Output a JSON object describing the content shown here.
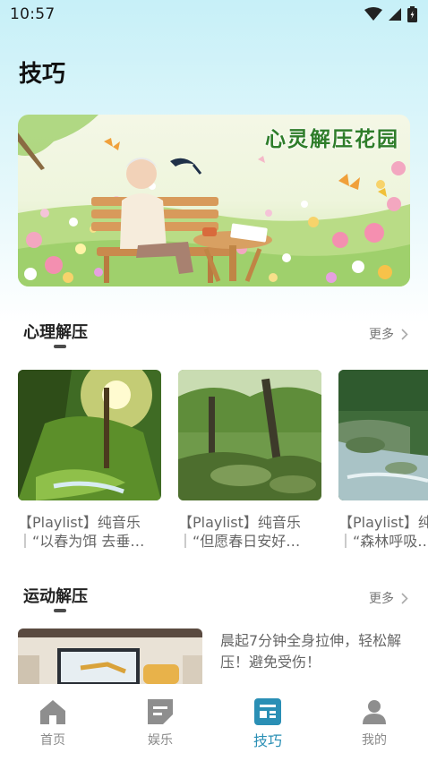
{
  "status_bar": {
    "time": "10:57"
  },
  "page": {
    "title": "技巧"
  },
  "banner": {
    "title": "心灵解压花园"
  },
  "sections": {
    "psych": {
      "title": "心理解压",
      "more": "更多"
    },
    "sport": {
      "title": "运动解压",
      "more": "更多"
    }
  },
  "playlists": [
    {
      "line1": "【Playlist】纯音乐",
      "line2": "｜“以春为饵 去垂…"
    },
    {
      "line1": "【Playlist】纯音乐",
      "line2": "｜“但愿春日安好…"
    },
    {
      "line1": "【Playlist】纯音乐",
      "line2": "｜“森林呼吸…"
    }
  ],
  "exercise": {
    "text": "晨起7分钟全身拉伸，轻松解压！避免受伤！"
  },
  "nav": [
    {
      "label": "首页",
      "icon": "home-icon",
      "active": false
    },
    {
      "label": "娱乐",
      "icon": "entertainment-icon",
      "active": false
    },
    {
      "label": "技巧",
      "icon": "tips-icon",
      "active": true
    },
    {
      "label": "我的",
      "icon": "profile-icon",
      "active": false
    }
  ],
  "colors": {
    "accent": "#2a8fb5",
    "banner_title": "#2f7d2a",
    "inactive_nav": "#8a8a8a"
  }
}
